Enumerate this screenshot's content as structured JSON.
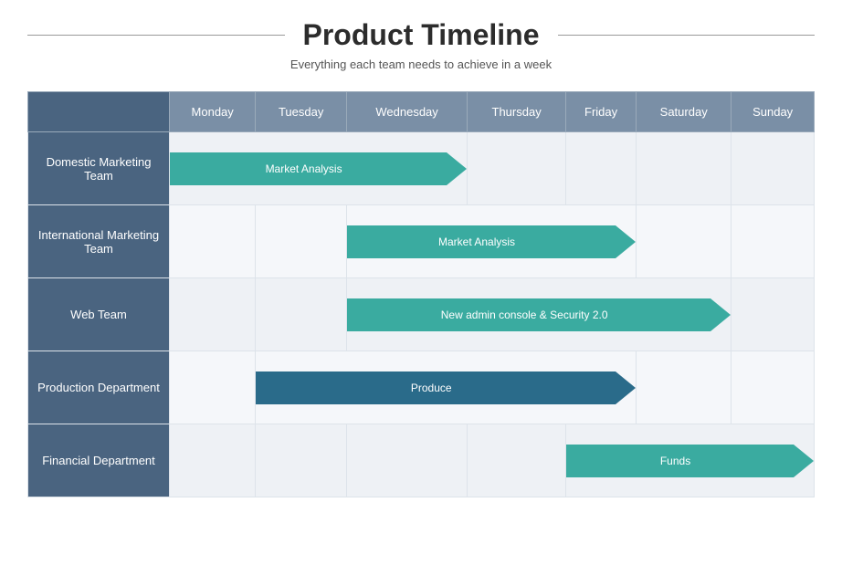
{
  "header": {
    "title": "Product Timeline",
    "subtitle": "Everything each team needs to achieve in a week",
    "line_char": "—"
  },
  "columns": {
    "label": "",
    "days": [
      "Monday",
      "Tuesday",
      "Wednesday",
      "Thursday",
      "Friday",
      "Saturday",
      "Sunday"
    ]
  },
  "rows": [
    {
      "label": "Domestic Marketing Team",
      "task": "Market Analysis",
      "start": 1,
      "end": 3,
      "variant": "teal"
    },
    {
      "label": "International Marketing Team",
      "task": "Market Analysis",
      "start": 3,
      "end": 5,
      "variant": "teal"
    },
    {
      "label": "Web Team",
      "task": "New admin console & Security 2.0",
      "start": 3,
      "end": 6,
      "variant": "teal"
    },
    {
      "label": "Production Department",
      "task": "Produce",
      "start": 2,
      "end": 5,
      "variant": "dark"
    },
    {
      "label": "Financial Department",
      "task": "Funds",
      "start": 5,
      "end": 7,
      "variant": "teal"
    }
  ]
}
